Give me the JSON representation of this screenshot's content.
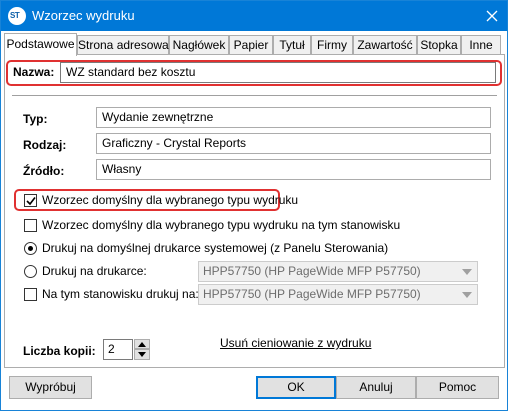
{
  "window": {
    "title": "Wzorzec wydruku"
  },
  "tabs": [
    {
      "label": "Podstawowe"
    },
    {
      "label": "Strona adresowa"
    },
    {
      "label": "Nagłówek"
    },
    {
      "label": "Papier"
    },
    {
      "label": "Tytuł"
    },
    {
      "label": "Firmy"
    },
    {
      "label": "Zawartość"
    },
    {
      "label": "Stopka"
    },
    {
      "label": "Inne"
    }
  ],
  "form": {
    "name_label": "Nazwa:",
    "name_value": "WZ standard bez kosztu",
    "type_label": "Typ:",
    "type_value": "Wydanie zewnętrzne",
    "kind_label": "Rodzaj:",
    "kind_value": "Graficzny - Crystal Reports",
    "source_label": "Źródło:",
    "source_value": "Własny"
  },
  "options": {
    "default_pattern_label": "Wzorzec domyślny dla wybranego typu wydruku",
    "default_pattern_checked": true,
    "default_pattern_station_label": "Wzorzec domyślny dla wybranego typu wydruku na tym stanowisku",
    "default_pattern_station_checked": false,
    "print_default_label": "Drukuj na domyślnej drukarce systemowej (z Panelu Sterowania)",
    "print_default_selected": true,
    "print_on_printer_label": "Drukuj na drukarce:",
    "print_on_printer_selected": false,
    "print_on_printer_value": "HPP57750 (HP PageWide MFP P57750)",
    "station_print_label": "Na tym stanowisku drukuj na:",
    "station_print_checked": false,
    "station_print_value": "HPP57750 (HP PageWide MFP P57750)"
  },
  "copies": {
    "label": "Liczba kopii:",
    "value": "2"
  },
  "remove_shading_link": "Usuń cieniowanie z wydruku",
  "buttons": {
    "preview": "Wypróbuj",
    "ok": "OK",
    "cancel": "Anuluj",
    "help": "Pomoc"
  },
  "colors": {
    "titlebar": "#0078d7",
    "highlight": "#e03131"
  }
}
